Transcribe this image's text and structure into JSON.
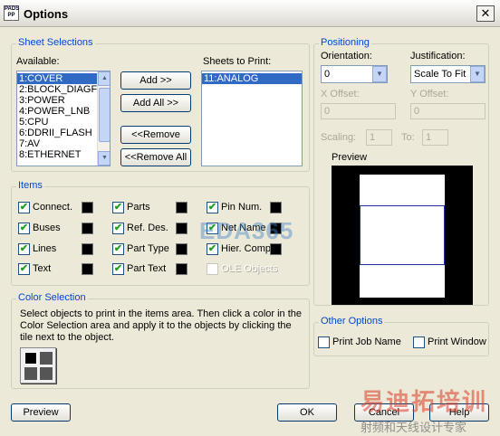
{
  "window": {
    "title": "Options",
    "app_icon": "PADS\nPP",
    "close_glyph": "✕"
  },
  "sheet_selections": {
    "legend": "Sheet Selections",
    "available_label": "Available:",
    "available_items": [
      "1:COVER",
      "2:BLOCK_DIAGF",
      "3:POWER",
      "4:POWER_LNB",
      "5:CPU",
      "6:DDRII_FLASH",
      "7:AV",
      "8:ETHERNET"
    ],
    "selected_index": 0,
    "sheets_label": "Sheets to Print:",
    "sheets_items": [
      "11:ANALOG"
    ],
    "add_button": "Add >>",
    "add_all_button": "Add  All >>",
    "remove_button": "<<Remove",
    "remove_all_button": "<<Remove All"
  },
  "items": {
    "legend": "Items",
    "checkboxes": [
      {
        "label": "Connect.",
        "checked": true
      },
      {
        "label": "Buses",
        "checked": true
      },
      {
        "label": "Lines",
        "checked": true
      },
      {
        "label": "Text",
        "checked": true
      },
      {
        "label": "Parts",
        "checked": true
      },
      {
        "label": "Ref. Des.",
        "checked": true
      },
      {
        "label": "Part Type",
        "checked": true
      },
      {
        "label": "Part Text",
        "checked": true
      },
      {
        "label": "Pin Num.",
        "checked": true
      },
      {
        "label": "Net Name",
        "checked": true
      },
      {
        "label": "Hier. Comp.",
        "checked": true
      },
      {
        "label": "OLE Objects",
        "checked": false,
        "disabled": true
      }
    ]
  },
  "color_selection": {
    "legend": "Color Selection",
    "description": "Select objects to print in the items area. Then click a color in the Color Selection area and apply it to the objects by clicking the tile next to the object."
  },
  "positioning": {
    "legend": "Positioning",
    "orientation_label": "Orientation:",
    "orientation_value": "0",
    "justification_label": "Justification:",
    "justification_value": "Scale To Fit",
    "x_offset_label": "X Offset:",
    "x_offset_value": "0",
    "y_offset_label": "Y Offset:",
    "y_offset_value": "0",
    "scaling_label": "Scaling:",
    "scaling_value": "1",
    "to_label": "To:",
    "to_value": "1",
    "preview_label": "Preview"
  },
  "other_options": {
    "legend": "Other Options",
    "print_job_name": "Print Job Name",
    "print_window": "Print Window"
  },
  "footer": {
    "preview_button": "Preview",
    "ok_button": "OK",
    "cancel_button": "Cancel",
    "help_button": "Help"
  },
  "watermarks": {
    "top": "EDA365",
    "bottom_line1": "易迪拓培训",
    "bottom_line2": "射频和天线设计专家"
  }
}
